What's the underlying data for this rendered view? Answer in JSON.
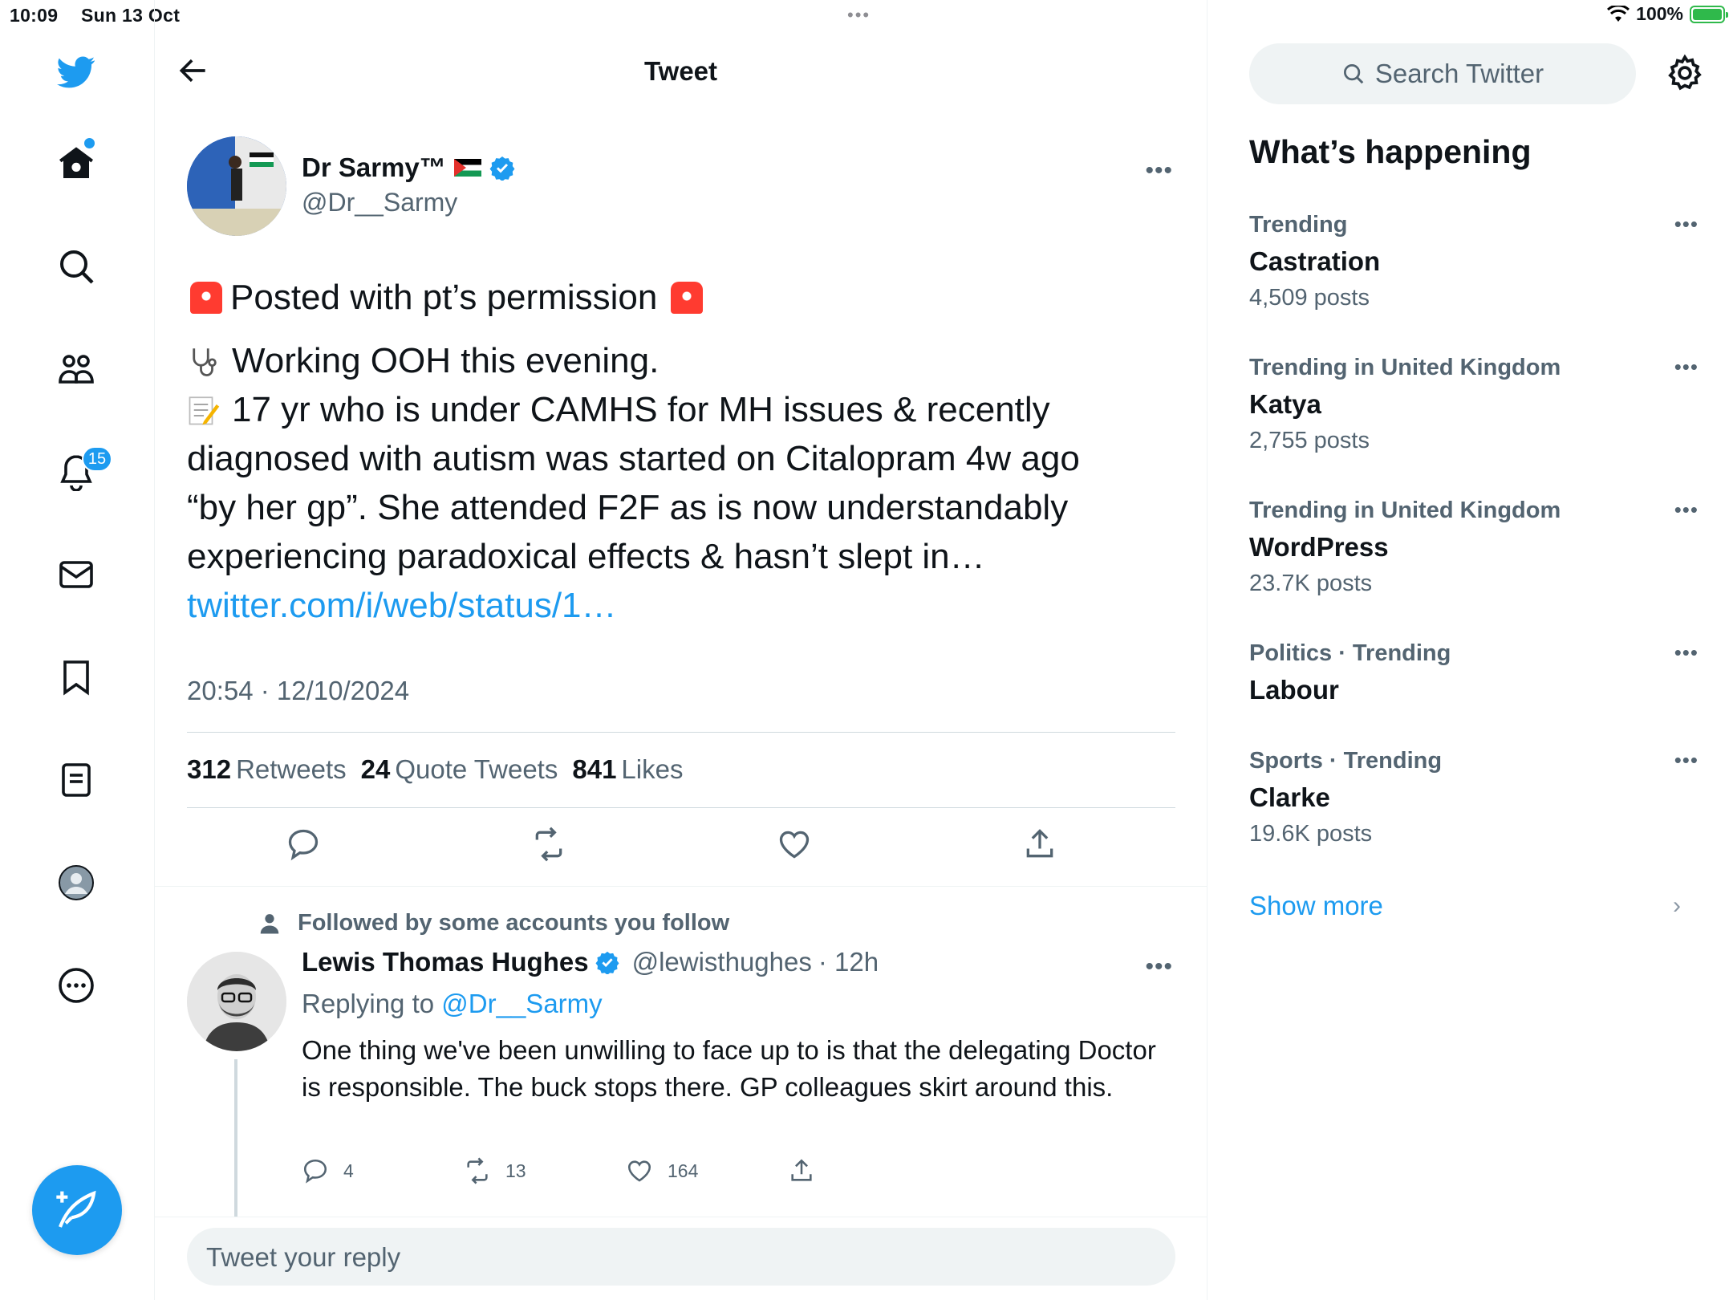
{
  "status_bar": {
    "time": "10:09",
    "date": "Sun 13 Oct",
    "dots": "•••",
    "battery": "100%"
  },
  "nav": {
    "icons": [
      "twitter-logo",
      "home-icon",
      "search-icon",
      "communities-icon",
      "notifications-icon",
      "messages-icon",
      "bookmarks-icon",
      "lists-icon",
      "profile-icon",
      "more-icon"
    ],
    "notifications_badge": "15",
    "compose_icon": "compose-icon",
    "brand_color": "#1d9bf0"
  },
  "header": {
    "title": "Tweet"
  },
  "tweet": {
    "author_name": "Dr Sarmy™",
    "author_handle": "@Dr__Sarmy",
    "line1": "Posted with pt’s permission",
    "line2": "Working OOH this evening.",
    "line3a": "17 yr who is under CAMHS for MH issues & recently",
    "line3b": "diagnosed with autism was started on Citalopram 4w ago",
    "line3c": "“by her gp”. She attended F2F as is now understandably",
    "line3d": "experiencing paradoxical effects & hasn’t slept in…",
    "link": "twitter.com/i/web/status/1…",
    "timestamp": "20:54 · 12/10/2024",
    "retweets_count": "312",
    "retweets_label": "Retweets",
    "quotes_count": "24",
    "quotes_label": "Quote Tweets",
    "likes_count": "841",
    "likes_label": "Likes"
  },
  "reply": {
    "social_context": "Followed by some accounts you follow",
    "name": "Lewis Thomas Hughes",
    "handle": "@lewisthughes",
    "time": "· 12h",
    "replying_label": "Replying to",
    "replying_handle": "@Dr__Sarmy",
    "text": "One thing we've been unwilling to face up to is that the delegating Doctor is responsible. The buck stops there. GP colleagues skirt around this.",
    "replies": "4",
    "retweets": "13",
    "likes": "164"
  },
  "reply_box": {
    "placeholder": "Tweet your reply"
  },
  "sidebar": {
    "search_placeholder": "Search Twitter",
    "heading": "What’s happening",
    "trends": [
      {
        "category": "Trending",
        "name": "Castration",
        "count": "4,509 posts"
      },
      {
        "category": "Trending in United Kingdom",
        "name": "Katya",
        "count": "2,755 posts"
      },
      {
        "category": "Trending in United Kingdom",
        "name": "WordPress",
        "count": "23.7K posts"
      },
      {
        "category": "Politics · Trending",
        "name": "Labour",
        "count": ""
      },
      {
        "category": "Sports · Trending",
        "name": "Clarke",
        "count": "19.6K posts"
      }
    ],
    "show_more": "Show more"
  }
}
